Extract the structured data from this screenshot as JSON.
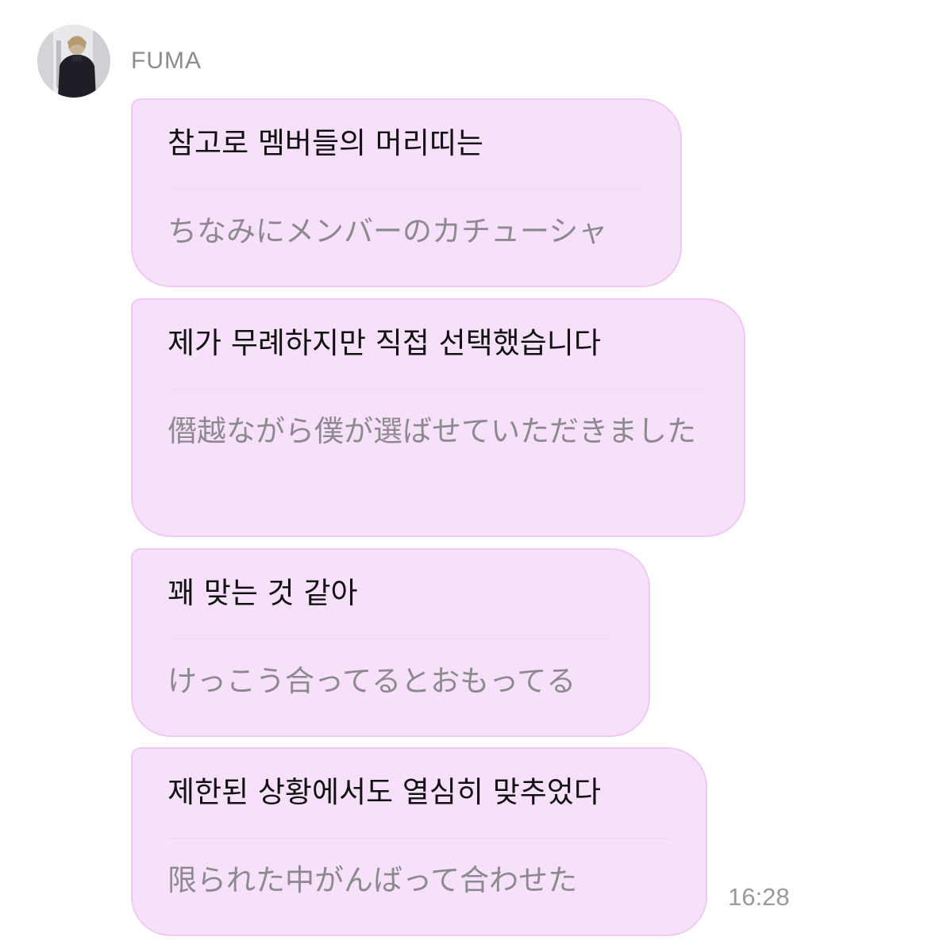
{
  "chat": {
    "sender": {
      "name": "FUMA",
      "avatar": "profile-photo"
    },
    "messages": [
      {
        "korean": "참고로 멤버들의 머리띠는",
        "japanese": "ちなみにメンバーのカチューシャ"
      },
      {
        "korean": "제가 무례하지만 직접 선택했습니다",
        "japanese": "僭越ながら僕が選ばせていただきました"
      },
      {
        "korean": "꽤 맞는 것 같아",
        "japanese": "けっこう合ってるとおもってる"
      },
      {
        "korean": "제한된 상황에서도 열심히 맞추었다",
        "japanese": "限られた中がんばって合わせた"
      }
    ],
    "timestamp": "16:28"
  },
  "colors": {
    "bubble_background": "#f7e1fa",
    "bubble_border": "#efc9f2",
    "primary_text": "#111111",
    "secondary_text": "#8d8a8f",
    "meta_text": "#9a9a9a"
  }
}
